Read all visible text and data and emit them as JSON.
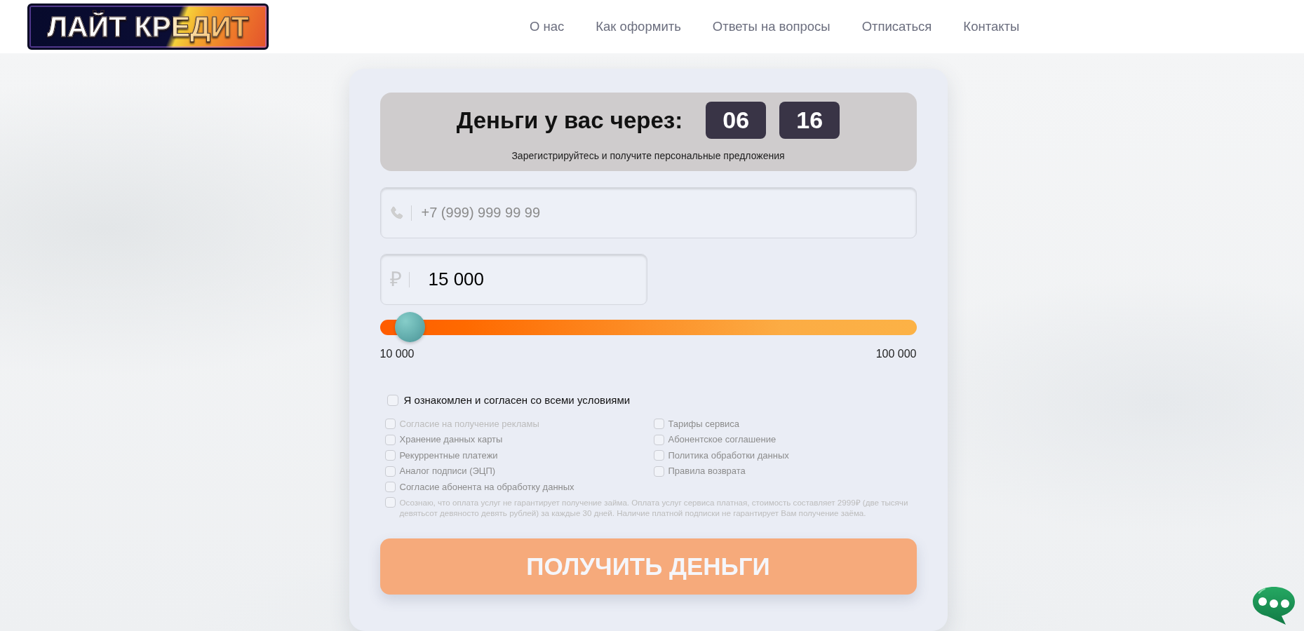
{
  "header": {
    "logo_text": "ЛАЙТ КРЕДИТ",
    "nav": [
      {
        "label": "О нас"
      },
      {
        "label": "Как оформить"
      },
      {
        "label": "Ответы на вопросы"
      },
      {
        "label": "Отписаться"
      },
      {
        "label": "Контакты"
      }
    ]
  },
  "form": {
    "timer": {
      "title": "Деньги у вас через:",
      "minutes": "06",
      "seconds": "16",
      "subtitle": "Зарегистрируйтесь и получите персональные предложения"
    },
    "phone_field": {
      "placeholder": "+7 (999) 999 99 99"
    },
    "amount_field": {
      "currency_symbol": "₽",
      "value": "15 000"
    },
    "amount_slider": {
      "level": 0.03,
      "min_label": "10 000",
      "max_label": "100 000"
    },
    "agree_all": {
      "label": "Я ознакомлен и согласен со всеми условиями",
      "checked": false
    },
    "consents": [
      {
        "label": "Согласие на получение рекламы",
        "checked": false,
        "faded": true
      },
      {
        "label": "Тарифы сервиса",
        "checked": false,
        "faded": false
      },
      {
        "label": "Хранение данных карты",
        "checked": false,
        "faded": false
      },
      {
        "label": "Абонентское соглашение",
        "checked": false,
        "faded": false
      },
      {
        "label": "Рекуррентные платежи",
        "checked": false,
        "faded": false
      },
      {
        "label": "Политика обработки данных",
        "checked": false,
        "faded": false
      },
      {
        "label": "Аналог подписи (ЭЦП)",
        "checked": false,
        "faded": false
      },
      {
        "label": "Правила возврата",
        "checked": false,
        "faded": false
      },
      {
        "label": "Согласие абонента на обработку данных",
        "checked": false,
        "faded": false
      }
    ],
    "disclaimer": {
      "text": "Осознаю, что оплата услуг не гарантирует получение займа. Оплата услуг сервиса платная, стоимость составляет 2999₽ (две тысячи девятьсот девяносто девять рублей) за каждые 30 дней. Наличие платной подписки не гарантирует Вам получение заёма.",
      "checked": false,
      "faded": true
    },
    "submit_button": {
      "label": "ПОЛУЧИТЬ ДЕНЬГИ",
      "disabled": true
    }
  }
}
